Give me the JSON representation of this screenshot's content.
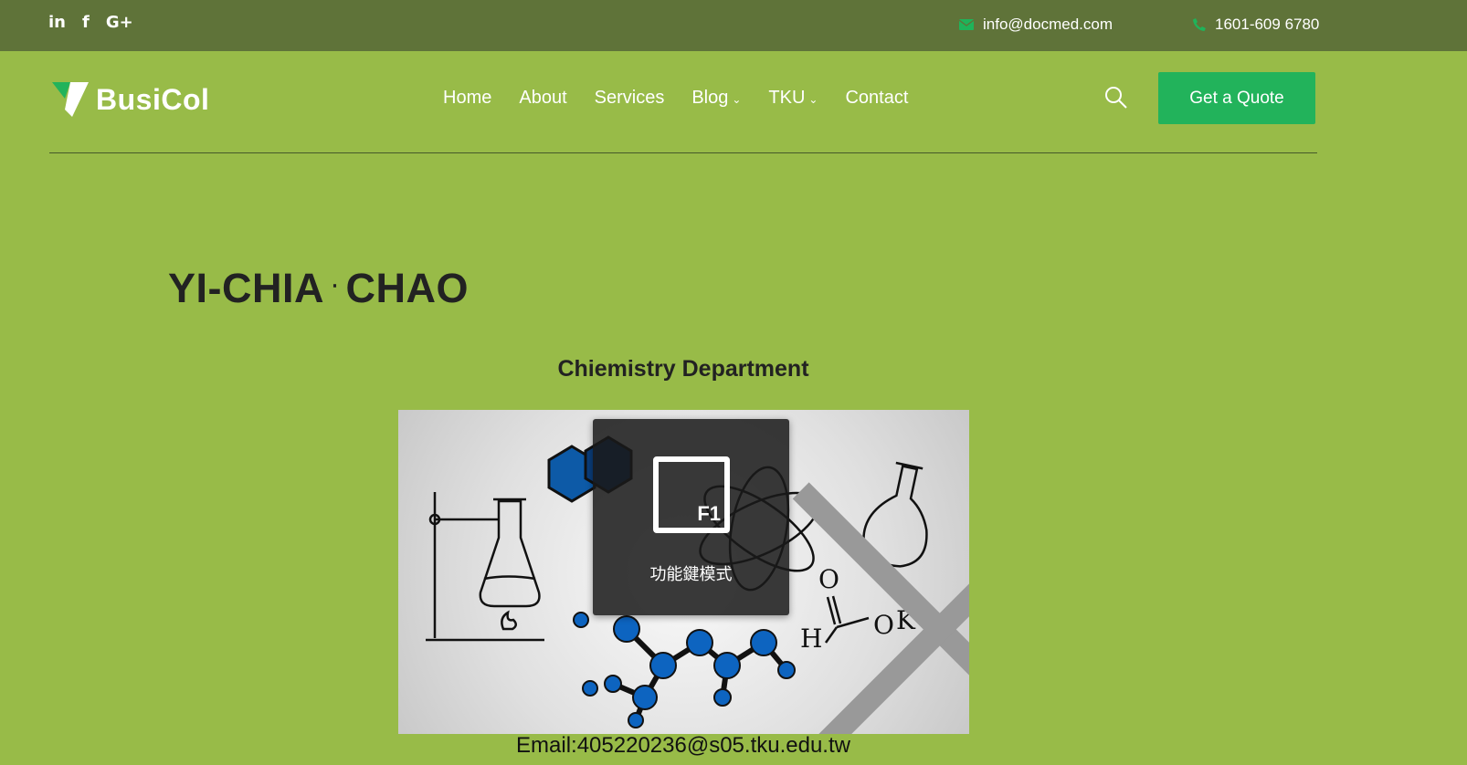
{
  "topbar": {
    "social": [
      {
        "label": "in",
        "icon": "linkedin-icon"
      },
      {
        "label": "f",
        "icon": "facebook-icon"
      },
      {
        "label": "G+",
        "icon": "google-plus-icon"
      }
    ],
    "email": "info@docmed.com",
    "phone": "1601-609 6780",
    "background": "#5f7339"
  },
  "header": {
    "logo_text": "BusiCol",
    "nav": [
      {
        "label": "Home"
      },
      {
        "label": "About"
      },
      {
        "label": "Services"
      },
      {
        "label": "Blog",
        "dropdown": true
      },
      {
        "label": "TKU",
        "dropdown": true
      },
      {
        "label": "Contact"
      }
    ],
    "quote_button": "Get a Quote",
    "background": "#98bb48",
    "accent": "#22b35b"
  },
  "profile": {
    "first_name": "YI-CHIA",
    "separator": "‧",
    "last_name": "CHAO",
    "department": "Chiemistry Department",
    "email": "Email:405220236@s05.tku.edu.tw"
  },
  "overlay": {
    "key": "F1",
    "label": "功能鍵模式",
    "icon": "function-key-icon"
  }
}
